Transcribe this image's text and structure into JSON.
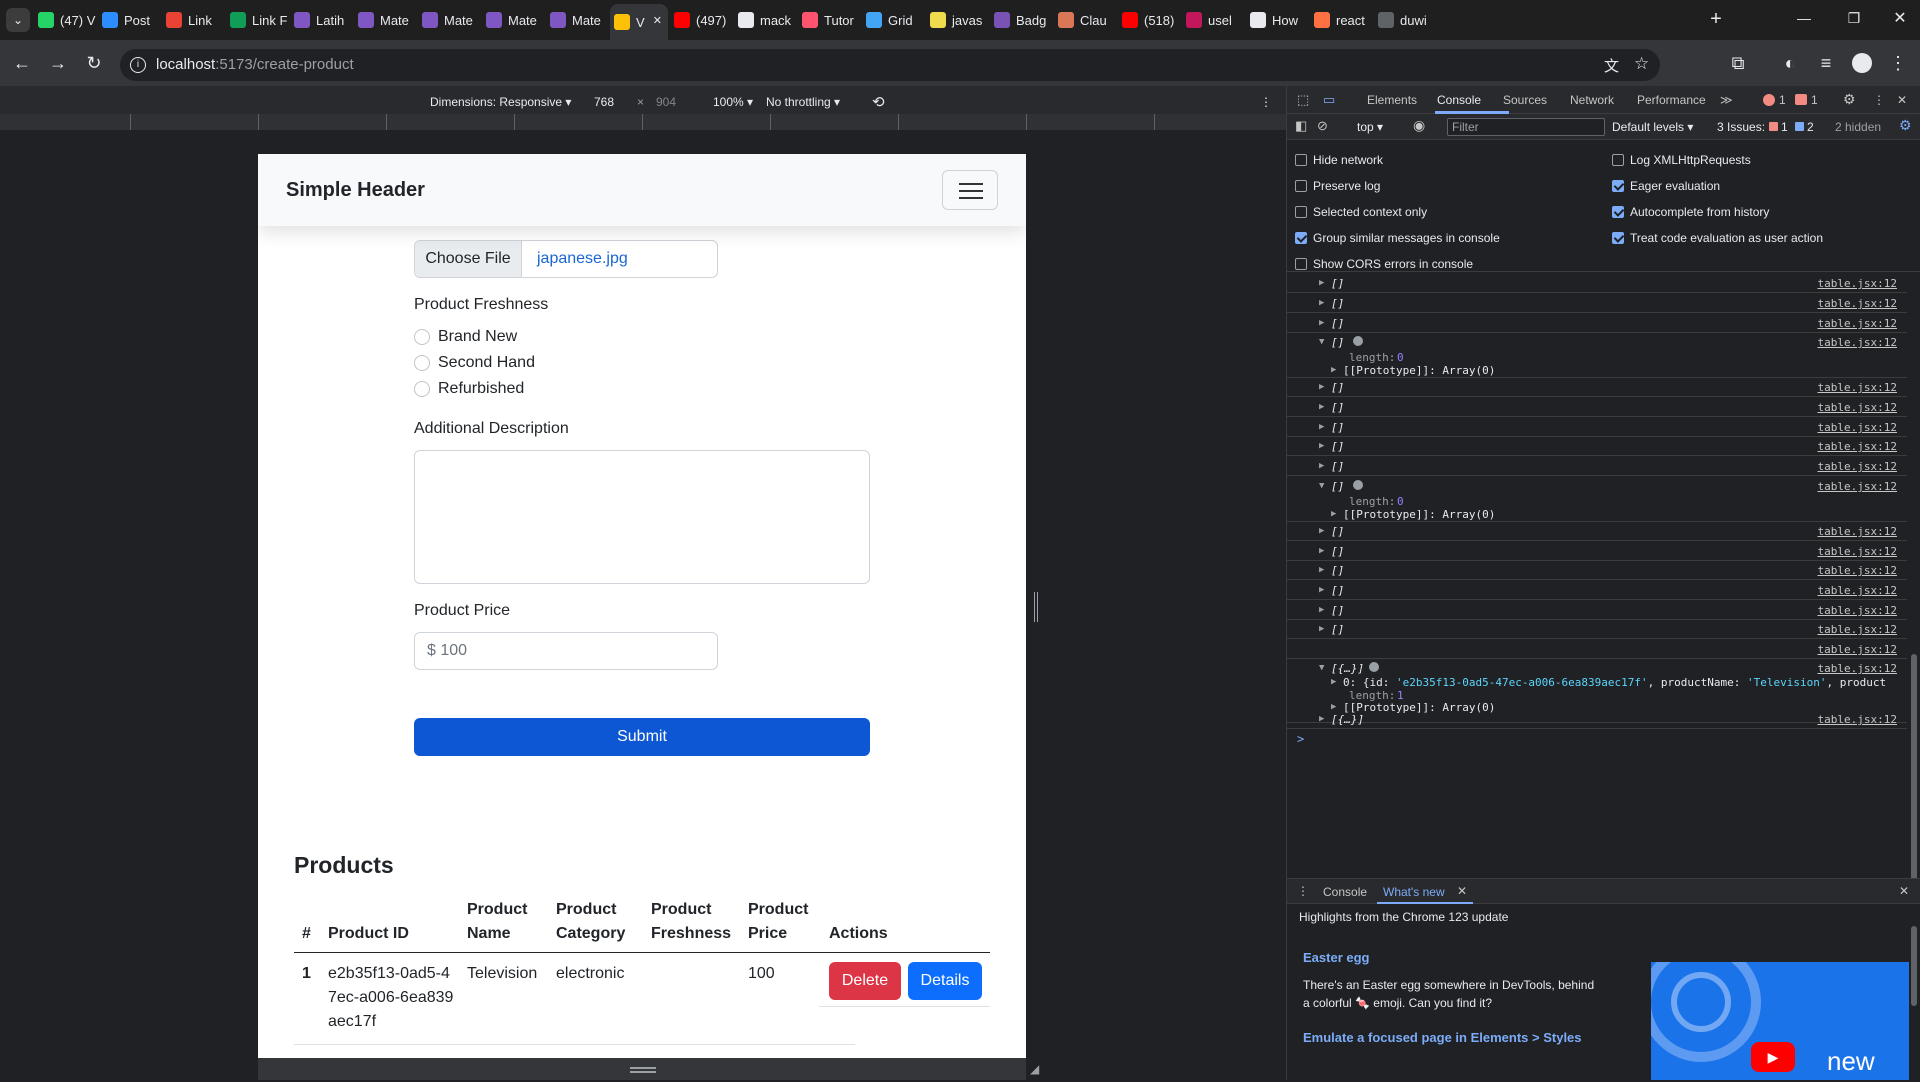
{
  "browser": {
    "tabs": [
      {
        "label": "(47) V",
        "color": "#25d366"
      },
      {
        "label": "Post",
        "color": "#2d8cff"
      },
      {
        "label": "Link",
        "color": "#ea4335"
      },
      {
        "label": "Link F",
        "color": "#0f9d58"
      },
      {
        "label": "Latih",
        "color": "#7e57c2"
      },
      {
        "label": "Mate",
        "color": "#7e57c2"
      },
      {
        "label": "Mate",
        "color": "#7e57c2"
      },
      {
        "label": "Mate",
        "color": "#7e57c2"
      },
      {
        "label": "Mate",
        "color": "#7e57c2"
      },
      {
        "label": "V",
        "color": "#ffc107",
        "active": true
      },
      {
        "label": "(497)",
        "color": "#ff0000"
      },
      {
        "label": "mack",
        "color": "#e8eaed"
      },
      {
        "label": "Tutor",
        "color": "#ff5470"
      },
      {
        "label": "Grid",
        "color": "#42a5f5"
      },
      {
        "label": "javas",
        "color": "#f0db4f"
      },
      {
        "label": "Badg",
        "color": "#7952b3"
      },
      {
        "label": "Clau",
        "color": "#d97757"
      },
      {
        "label": "(518)",
        "color": "#ff0000"
      },
      {
        "label": "usel",
        "color": "#c2185b"
      },
      {
        "label": "How",
        "color": "#e8eaed"
      },
      {
        "label": "react",
        "color": "#ff7043"
      },
      {
        "label": "duwi",
        "color": "#5f6368"
      }
    ],
    "url_host": "localhost",
    "url_path": ":5173/create-product"
  },
  "device_toolbar": {
    "dimensions": "Dimensions: Responsive ▾",
    "width": "768",
    "times": "×",
    "height": "904",
    "zoom": "100% ▾",
    "throttling": "No throttling ▾"
  },
  "site": {
    "brand": "Simple Header",
    "file_button": "Choose File",
    "file_name": "japanese.jpg",
    "freshness_label": "Product Freshness",
    "freshness_options": [
      "Brand New",
      "Second Hand",
      "Refurbished"
    ],
    "description_label": "Additional Description",
    "price_label": "Product Price",
    "price_placeholder": "$ 100",
    "submit": "Submit",
    "products_title": "Products",
    "table": {
      "headers": [
        "#",
        "Product ID",
        "Product Name",
        "Product Category",
        "Product Freshness",
        "Product Price",
        "Actions"
      ],
      "rows": [
        {
          "num": "1",
          "id": "e2b35f13-0ad5-47ec-a006-6ea839aec17f",
          "name": "Television",
          "category": "electronic",
          "freshness": "",
          "price": "100"
        }
      ],
      "delete": "Delete",
      "details": "Details"
    }
  },
  "devtools": {
    "tabs": [
      "Elements",
      "Console",
      "Sources",
      "Network",
      "Performance"
    ],
    "more": "≫",
    "errors": "1",
    "warnings": "1",
    "context": "top ▾",
    "filter_placeholder": "Filter",
    "levels": "Default levels ▾",
    "issues": "3 Issues:",
    "issues_err": "1",
    "issues_info": "2",
    "hidden": "2 hidden",
    "settings_left": [
      {
        "label": "Hide network",
        "checked": false
      },
      {
        "label": "Preserve log",
        "checked": false
      },
      {
        "label": "Selected context only",
        "checked": false
      },
      {
        "label": "Group similar messages in console",
        "checked": true
      },
      {
        "label": "Show CORS errors in console",
        "checked": false
      }
    ],
    "settings_right": [
      {
        "label": "Log XMLHttpRequests",
        "checked": false
      },
      {
        "label": "Eager evaluation",
        "checked": true
      },
      {
        "label": "Autocomplete from history",
        "checked": true
      },
      {
        "label": "Treat code evaluation as user action",
        "checked": true
      }
    ],
    "log_source": "table.jsx:12",
    "log_empty": "[]",
    "log_obj": "[{…}]",
    "length_key": "length:",
    "length_zero": "0",
    "length_one": "1",
    "prototype": "[[Prototype]]: Array(0)",
    "obj_entry_key": "0: {id: ",
    "obj_entry_id": "'e2b35f13-0ad5-47ec-a006-6ea839aec17f'",
    "obj_entry_mid": ", productName: ",
    "obj_entry_name": "'Television'",
    "obj_entry_tail": ", product",
    "prompt": ">",
    "drawer_tabs": [
      "Console",
      "What's new"
    ],
    "highlights": "Highlights from the Chrome 123 update",
    "easter_title": "Easter egg",
    "easter_body": "There's an Easter egg somewhere in DevTools, behind a colorful 🍬 emoji. Can you find it?",
    "emulate_link": "Emulate a focused page in Elements > Styles",
    "promo_text": "new"
  }
}
